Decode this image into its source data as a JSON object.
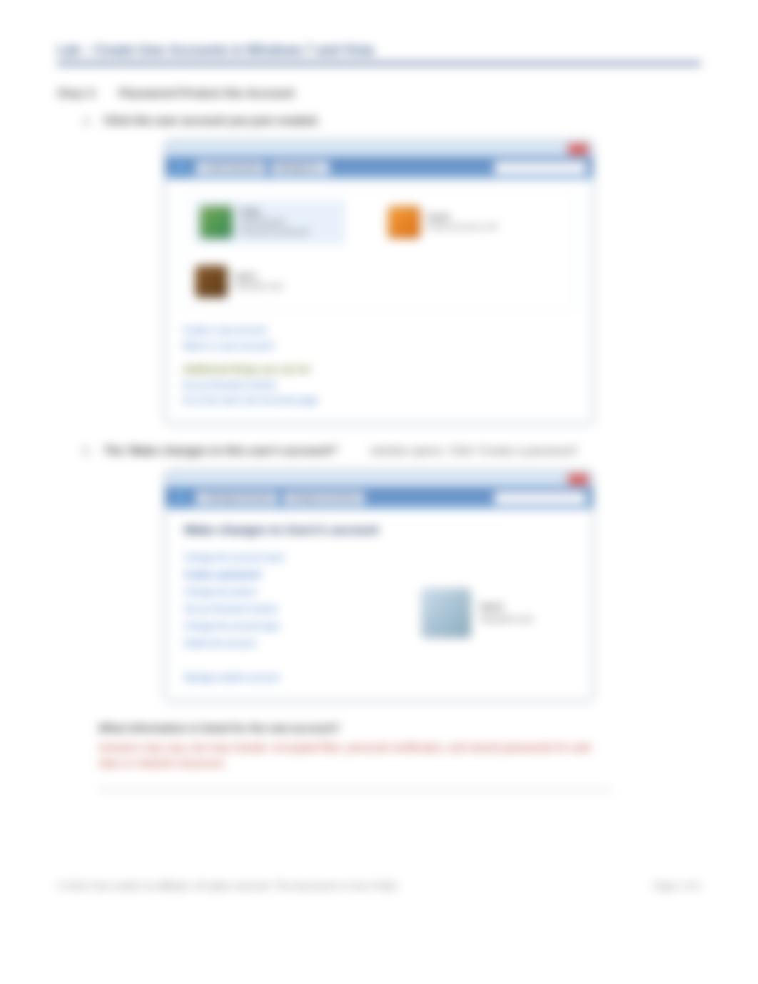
{
  "header": {
    "lab_title": "Lab – Create User Accounts in Windows 7 and Vista"
  },
  "step": {
    "label": "Step 3:",
    "desc": "Password Protect the Account"
  },
  "sub_a": {
    "letter": "a.",
    "text": "Click the user account you just created."
  },
  "sub_b": {
    "letter": "b.",
    "text_a": "The 'Make changes to this user's account?'",
    "text_b": "window opens. Click 'Create a password'."
  },
  "window1": {
    "crumbs": [
      "« User Accounts",
      "Manage Ac..."
    ],
    "accounts": [
      {
        "name": "Vicky",
        "line2": "Administrator",
        "line3": "Password protected"
      },
      {
        "name": "Guest",
        "line2": "Guest account is off",
        "line3": ""
      },
      {
        "name": "User1",
        "line2": "Standard user",
        "line3": ""
      }
    ],
    "links": [
      "Create a new account",
      "What is a user account?"
    ],
    "heading": "Additional things you can do",
    "more_links": [
      "Set up Parental Controls",
      "Go to the main User Accounts page"
    ]
  },
  "window2": {
    "crumbs": [
      "« Manage Accounts",
      "Change an Account"
    ],
    "title": "Make changes to User1's account",
    "links": [
      "Change the account name",
      "Create a password",
      "Change the picture",
      "Set up Parental Controls",
      "Change the account type",
      "Delete the account"
    ],
    "manage_link": "Manage another account",
    "card": {
      "name": "User1",
      "type": "Standard user"
    }
  },
  "question": {
    "q": "What information is listed for the new account?",
    "a": "Answers may vary, but may include: encrypted files, personal certificates, and stored passwords for web sites or network resources."
  },
  "footer": {
    "copyright": "© 2016 Cisco and/or its affiliates. All rights reserved. This document is Cisco Public.",
    "page": "Page 1 of 2"
  }
}
